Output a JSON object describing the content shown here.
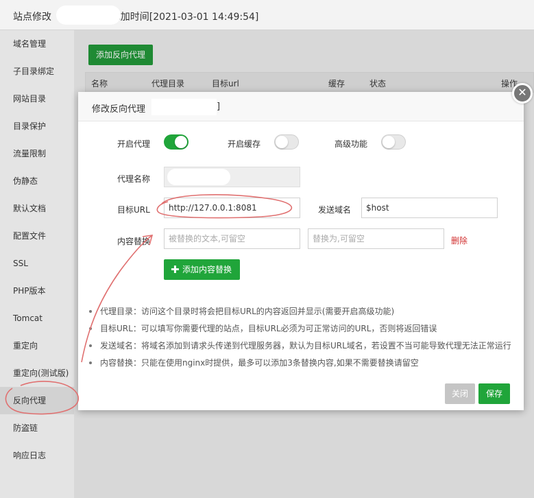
{
  "window": {
    "title": "站点修改              ] -- 添加时间[2021-03-01 14:49:54]"
  },
  "sidebar": {
    "items": [
      {
        "label": "域名管理"
      },
      {
        "label": "子目录绑定"
      },
      {
        "label": "网站目录"
      },
      {
        "label": "目录保护"
      },
      {
        "label": "流量限制"
      },
      {
        "label": "伪静态"
      },
      {
        "label": "默认文档"
      },
      {
        "label": "配置文件"
      },
      {
        "label": "SSL"
      },
      {
        "label": "PHP版本"
      },
      {
        "label": "Tomcat"
      },
      {
        "label": "重定向"
      },
      {
        "label": "重定向(测试版)"
      },
      {
        "label": "反向代理"
      },
      {
        "label": "防盗链"
      },
      {
        "label": "响应日志"
      }
    ],
    "active_item": "反向代理"
  },
  "main": {
    "add_button_label": "添加反向代理",
    "table_columns": [
      "名称",
      "代理目录",
      "目标url",
      "缓存",
      "状态",
      "操作"
    ]
  },
  "modal": {
    "title": "修改反向代理",
    "title_suffix": "]",
    "close_icon": "close-icon",
    "toggles": [
      {
        "label": "开启代理",
        "on": true
      },
      {
        "label": "开启缓存",
        "on": false
      },
      {
        "label": "高级功能",
        "on": false
      }
    ],
    "proxy_name_label": "代理名称",
    "proxy_name_value": "",
    "target_url_label": "目标URL",
    "target_url_value": "http://127.0.0.1:8081",
    "send_domain_label": "发送域名",
    "send_domain_value": "$host",
    "content_replace_label": "内容替换",
    "replace_from_placeholder": "被替换的文本,可留空",
    "replace_to_placeholder": "替换为,可留空",
    "delete_label": "删除",
    "add_replace_label": "添加内容替换",
    "tips": [
      "代理目录：访问这个目录时将会把目标URL的内容返回并显示(需要开启高级功能)",
      "目标URL：可以填写你需要代理的站点，目标URL必须为可正常访问的URL，否则将返回错误",
      "发送域名：将域名添加到请求头传递到代理服务器，默认为目标URL域名，若设置不当可能导致代理无法正常运行",
      "内容替换：只能在使用nginx时提供，最多可以添加3条替换内容,如果不需要替换请留空"
    ],
    "close_button_label": "关闭",
    "save_button_label": "保存"
  },
  "colors": {
    "primary_green": "#20a53a",
    "delete_red": "#d12f2f",
    "annotation_red": "#e07070"
  }
}
